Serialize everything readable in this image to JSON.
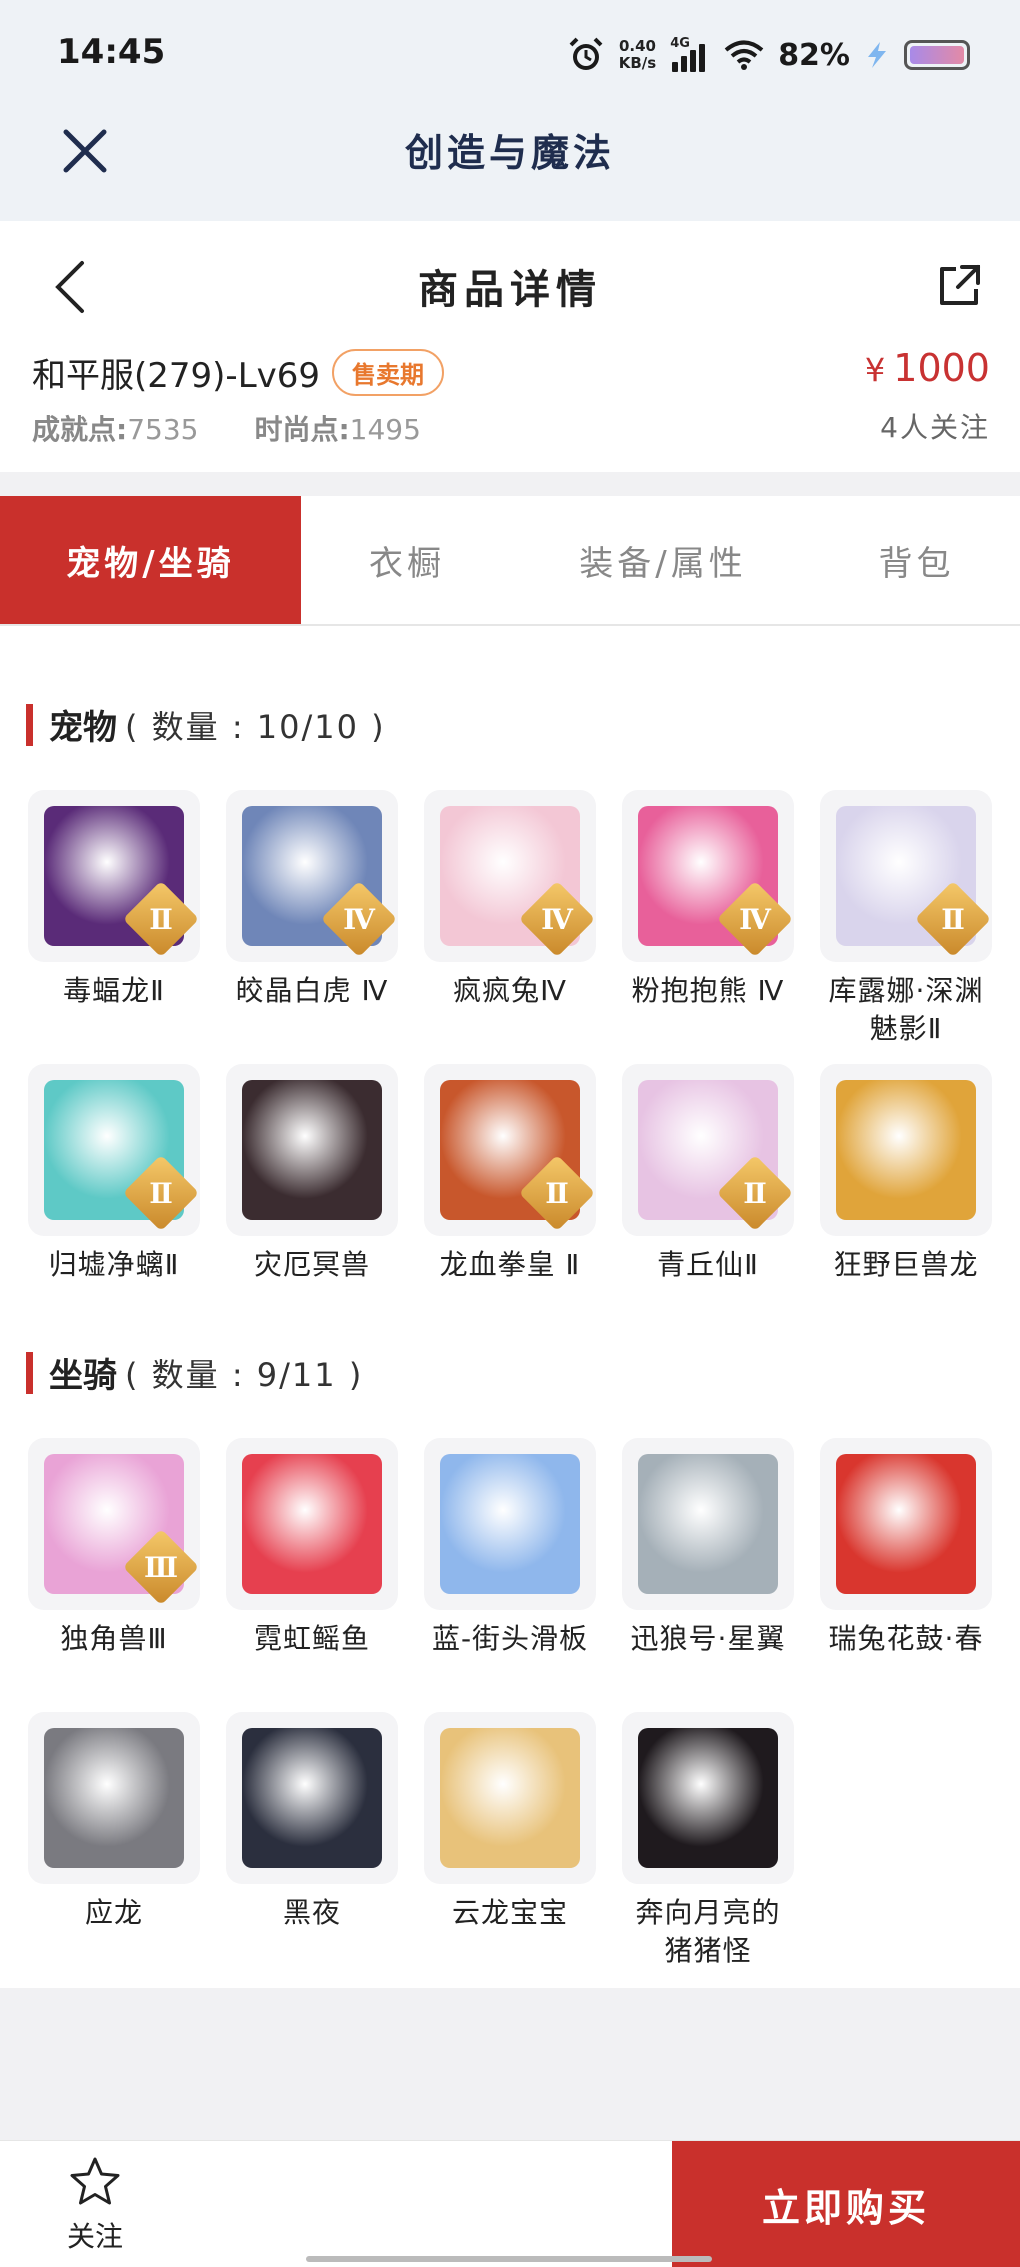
{
  "status_bar": {
    "time": "14:45",
    "net_speed_value": "0.40",
    "net_speed_unit": "KB/s",
    "network": "4G",
    "battery": "82%"
  },
  "app_header": {
    "title": "创造与魔法"
  },
  "page_header": {
    "title": "商品详情"
  },
  "item": {
    "server": "和平服(279)-Lv69",
    "sale_badge": "售卖期",
    "achievement_label": "成就点:",
    "achievement_value": "7535",
    "fashion_label": "时尚点:",
    "fashion_value": "1495",
    "price_symbol": "¥",
    "price": "1000",
    "followers": "4人关注"
  },
  "tabs": [
    {
      "label": "宠物/坐骑",
      "active": true
    },
    {
      "label": "衣橱",
      "active": false
    },
    {
      "label": "装备/属性",
      "active": false
    },
    {
      "label": "背包",
      "active": false
    }
  ],
  "pets": {
    "title": "宠物",
    "count": "( 数量 : 10/10 )",
    "items": [
      {
        "name": "毒蝠龙Ⅱ",
        "tier": "Ⅱ",
        "color": "#5a2b78"
      },
      {
        "name": "皎晶白虎 Ⅳ",
        "tier": "Ⅳ",
        "color": "#6f86b8"
      },
      {
        "name": "疯疯兔Ⅳ",
        "tier": "Ⅳ",
        "color": "#f3c7d5"
      },
      {
        "name": "粉抱抱熊 Ⅳ",
        "tier": "Ⅳ",
        "color": "#e8609a"
      },
      {
        "name": "库露娜·深渊魅影Ⅱ",
        "tier": "Ⅱ",
        "color": "#d9d4ec"
      },
      {
        "name": "归墟净螭Ⅱ",
        "tier": "Ⅱ",
        "color": "#5ec9c6"
      },
      {
        "name": "灾厄冥兽",
        "tier": "",
        "color": "#3b2c30"
      },
      {
        "name": "龙血拳皇 Ⅱ",
        "tier": "Ⅱ",
        "color": "#c8572c"
      },
      {
        "name": "青丘仙Ⅱ",
        "tier": "Ⅱ",
        "color": "#e7c3e3"
      },
      {
        "name": "狂野巨兽龙",
        "tier": "",
        "color": "#e0a43a"
      }
    ]
  },
  "mounts": {
    "title": "坐骑",
    "count": "( 数量 : 9/11 )",
    "items": [
      {
        "name": "独角兽Ⅲ",
        "tier": "Ⅲ",
        "color": "#e9a3d6"
      },
      {
        "name": "霓虹鳐鱼",
        "tier": "",
        "color": "#e6404f"
      },
      {
        "name": "蓝-街头滑板",
        "tier": "",
        "color": "#8fb7ec"
      },
      {
        "name": "迅狼号·星翼",
        "tier": "",
        "color": "#a5b0b8"
      },
      {
        "name": "瑞兔花鼓·春",
        "tier": "",
        "color": "#d9362e"
      },
      {
        "name": "应龙",
        "tier": "",
        "color": "#7a7a80"
      },
      {
        "name": "黑夜",
        "tier": "",
        "color": "#2b2f3e"
      },
      {
        "name": "云龙宝宝",
        "tier": "",
        "color": "#e8c27a"
      },
      {
        "name": "奔向月亮的猪猪怪",
        "tier": "",
        "color": "#1f1a1e"
      }
    ]
  },
  "bottom_bar": {
    "follow_label": "关注",
    "buy_label": "立即购买"
  }
}
